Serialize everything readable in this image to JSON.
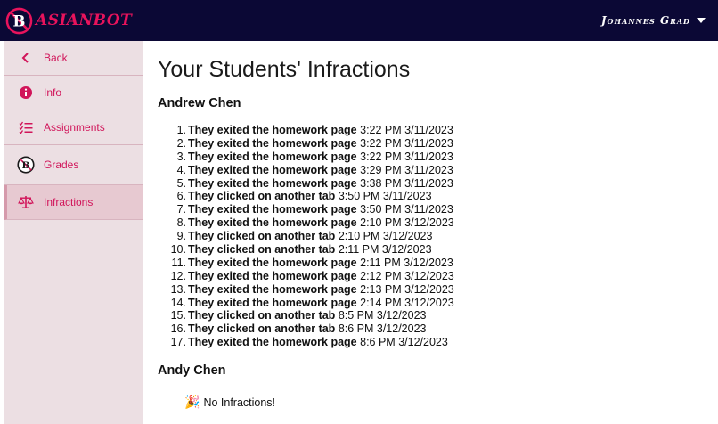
{
  "header": {
    "brand_name": "ASIANBOT",
    "user_name": "Johannes Grad",
    "colors": {
      "bar": "#0b0835",
      "accent": "#e8135c"
    }
  },
  "sidebar": {
    "items": [
      {
        "label": "Back",
        "icon": "chevron-left-icon"
      },
      {
        "label": "Info",
        "icon": "info-icon"
      },
      {
        "label": "Assignments",
        "icon": "checklist-icon"
      },
      {
        "label": "Grades",
        "icon": "asianbot-logo-icon"
      },
      {
        "label": "Infractions",
        "icon": "scale-icon",
        "active": true
      }
    ]
  },
  "main": {
    "title": "Your Students' Infractions",
    "students": [
      {
        "name": "Andrew Chen",
        "infractions": [
          {
            "n": "1.",
            "action": "They exited the homework page",
            "time": "3:22 PM 3/11/2023"
          },
          {
            "n": "2.",
            "action": "They exited the homework page",
            "time": "3:22 PM 3/11/2023"
          },
          {
            "n": "3.",
            "action": "They exited the homework page",
            "time": "3:22 PM 3/11/2023"
          },
          {
            "n": "4.",
            "action": "They exited the homework page",
            "time": "3:29 PM 3/11/2023"
          },
          {
            "n": "5.",
            "action": "They exited the homework page",
            "time": "3:38 PM 3/11/2023"
          },
          {
            "n": "6.",
            "action": "They clicked on another tab",
            "time": "3:50 PM 3/11/2023"
          },
          {
            "n": "7.",
            "action": "They exited the homework page",
            "time": "3:50 PM 3/11/2023"
          },
          {
            "n": "8.",
            "action": "They exited the homework page",
            "time": "2:10 PM 3/12/2023"
          },
          {
            "n": "9.",
            "action": "They clicked on another tab",
            "time": "2:10 PM 3/12/2023"
          },
          {
            "n": "10.",
            "action": "They clicked on another tab",
            "time": "2:11 PM 3/12/2023"
          },
          {
            "n": "11.",
            "action": "They exited the homework page",
            "time": "2:11 PM 3/12/2023"
          },
          {
            "n": "12.",
            "action": "They exited the homework page",
            "time": "2:12 PM 3/12/2023"
          },
          {
            "n": "13.",
            "action": "They exited the homework page",
            "time": "2:13 PM 3/12/2023"
          },
          {
            "n": "14.",
            "action": "They exited the homework page",
            "time": "2:14 PM 3/12/2023"
          },
          {
            "n": "15.",
            "action": "They clicked on another tab",
            "time": "8:5 PM 3/12/2023"
          },
          {
            "n": "16.",
            "action": "They clicked on another tab",
            "time": "8:6 PM 3/12/2023"
          },
          {
            "n": "17.",
            "action": "They exited the homework page",
            "time": "8:6 PM 3/12/2023"
          }
        ]
      },
      {
        "name": "Andy Chen",
        "no_infractions_emoji": "🎉",
        "no_infractions_text": "No Infractions!"
      }
    ]
  }
}
